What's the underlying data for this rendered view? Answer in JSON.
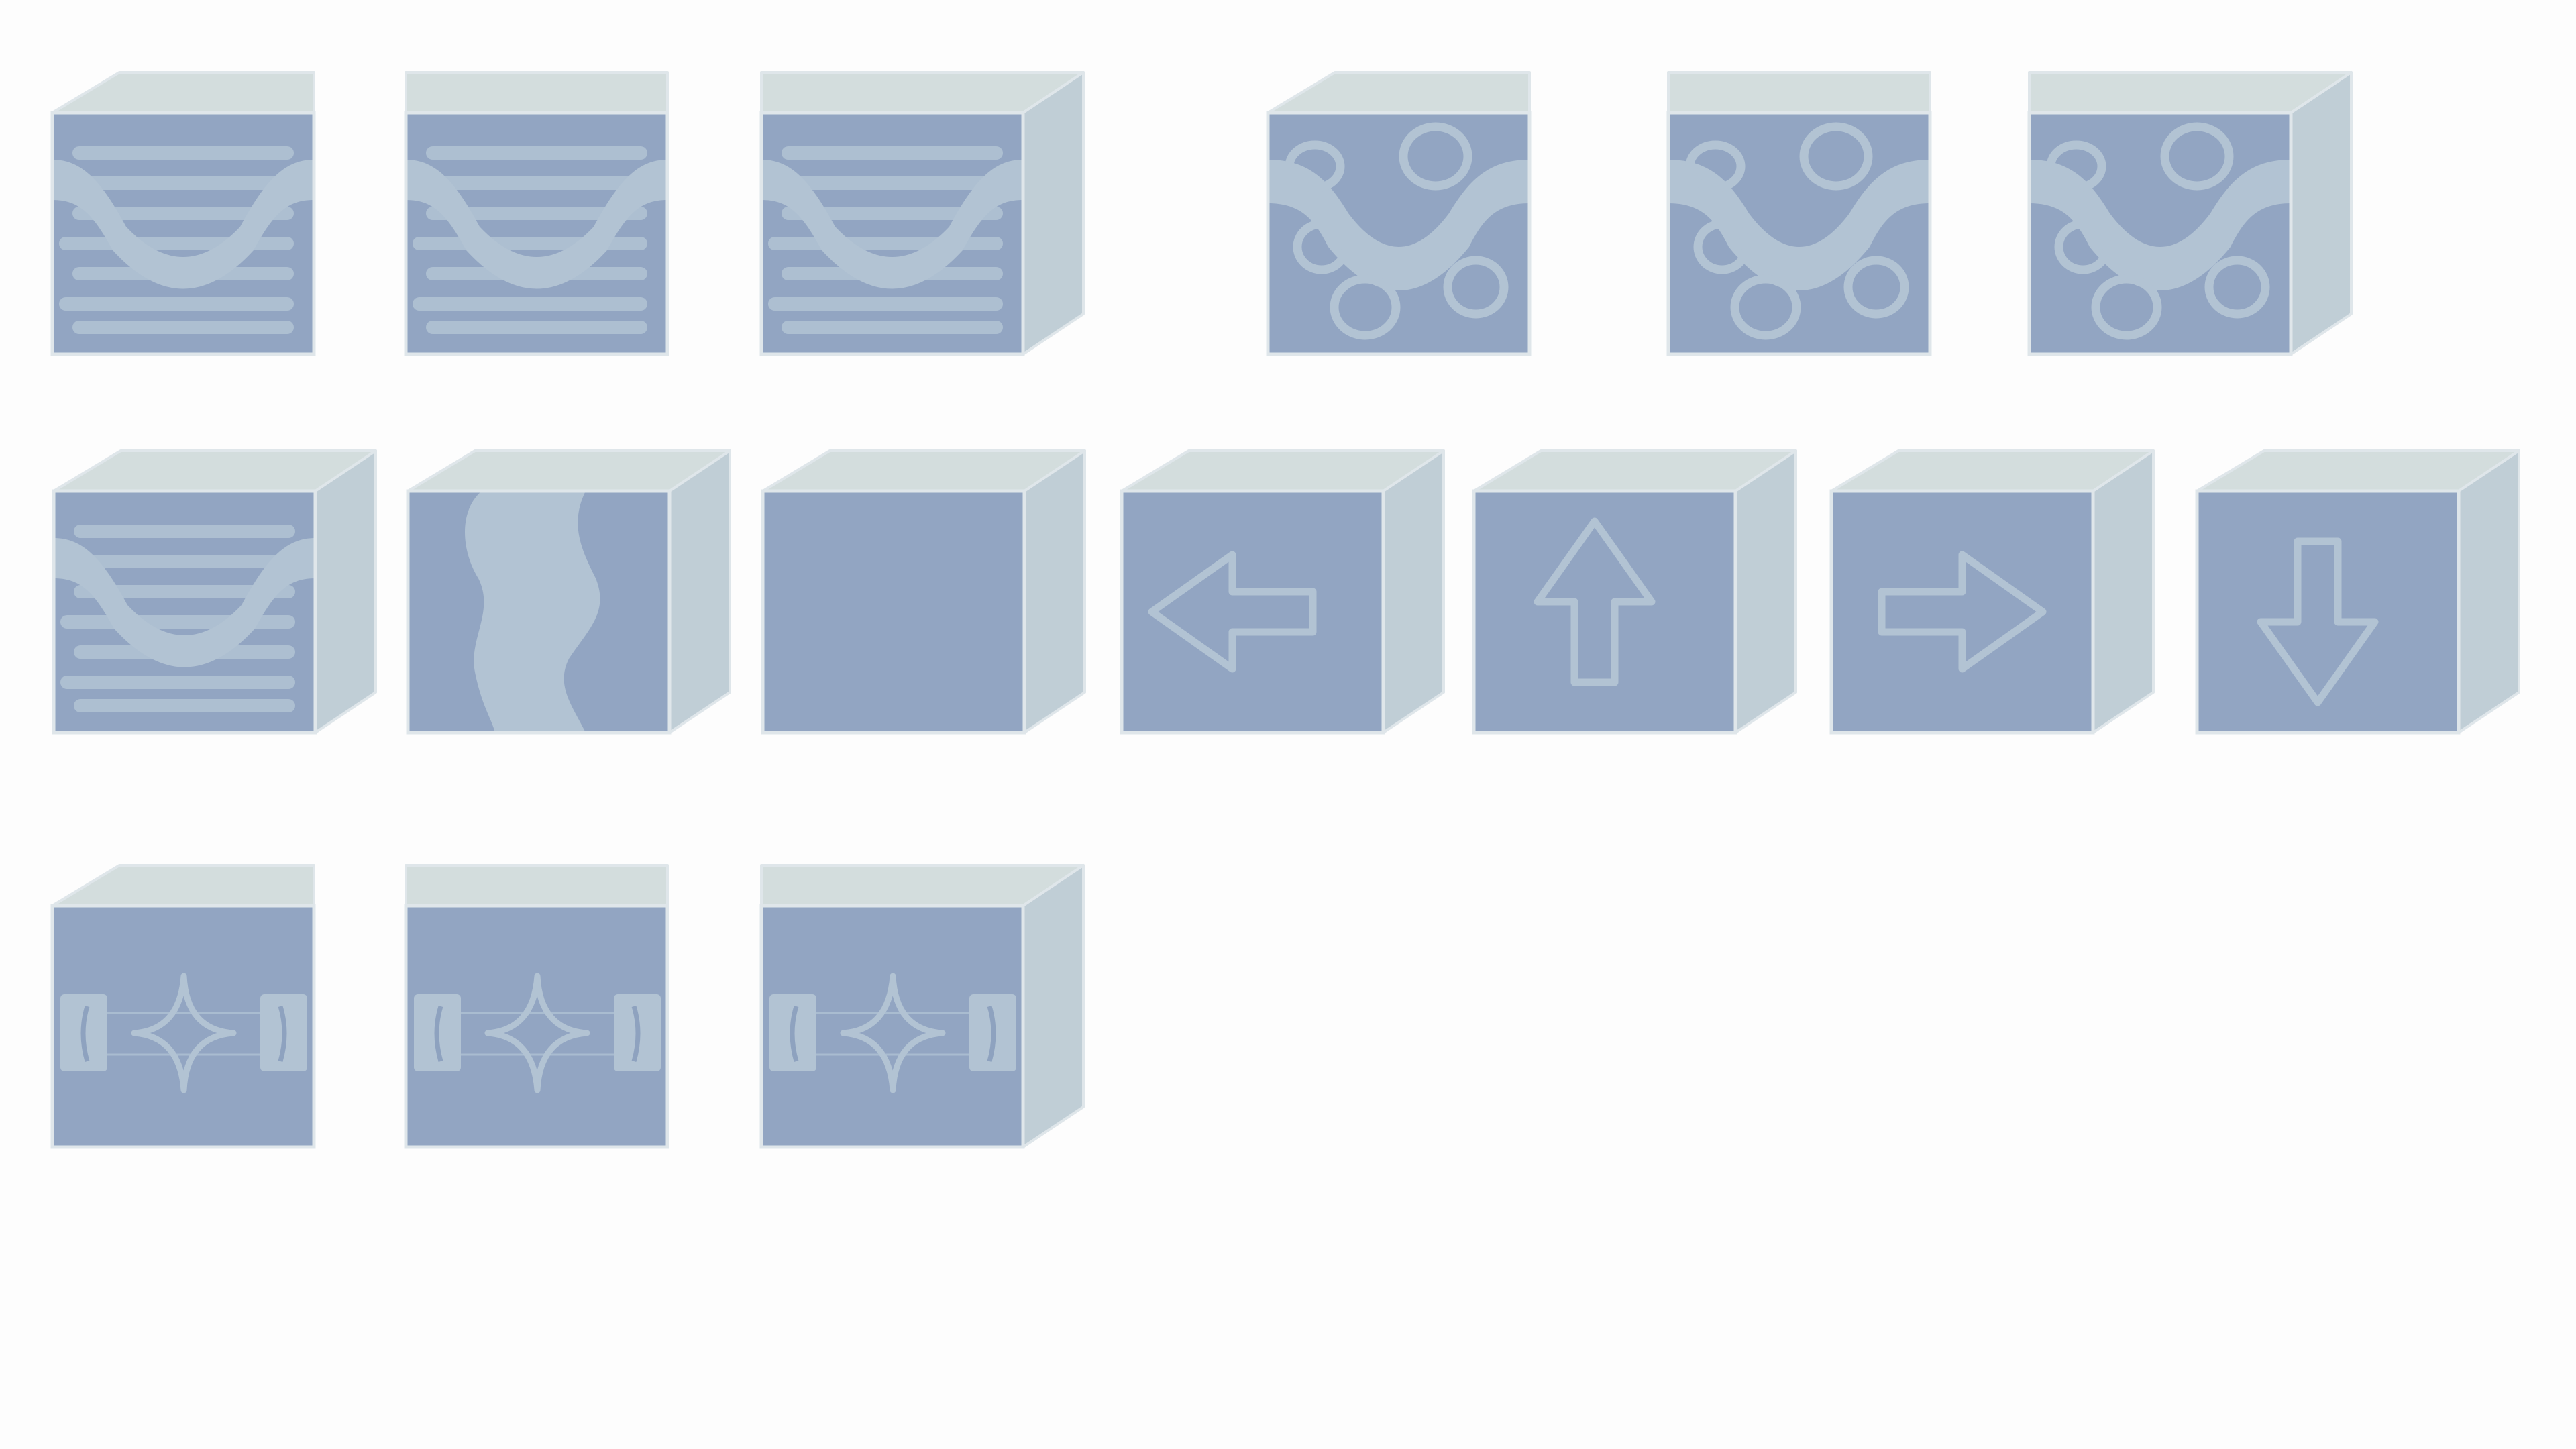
{
  "palette": {
    "face": "#92a5c2",
    "top": "#d3dddd",
    "side": "#c0ced6",
    "edge": "#dfe6ea",
    "pattern": "#b2c3d3",
    "pattern_line": "#a9bcd0",
    "background": "#fdfdfd"
  },
  "rows": [
    {
      "tiles": [
        {
          "pattern": "dunes-lines",
          "view": "front"
        },
        {
          "pattern": "dunes-lines",
          "view": "flat"
        },
        {
          "pattern": "dunes-lines",
          "view": "right"
        },
        null,
        {
          "pattern": "wave-circles",
          "view": "front"
        },
        {
          "pattern": "wave-circles",
          "view": "flat"
        },
        {
          "pattern": "wave-circles",
          "view": "right"
        }
      ]
    },
    {
      "tiles": [
        {
          "pattern": "dunes-lines",
          "view": "full"
        },
        {
          "pattern": "vertical-wave",
          "view": "full"
        },
        {
          "pattern": "blank",
          "view": "full"
        },
        {
          "pattern": "arrow-left",
          "view": "full"
        },
        {
          "pattern": "arrow-up",
          "view": "full"
        },
        {
          "pattern": "arrow-right",
          "view": "full"
        },
        {
          "pattern": "arrow-down",
          "view": "full"
        }
      ]
    },
    {
      "tiles": [
        {
          "pattern": "star-caps",
          "view": "front"
        },
        {
          "pattern": "star-caps",
          "view": "flat"
        },
        {
          "pattern": "star-caps",
          "view": "right"
        }
      ]
    }
  ]
}
